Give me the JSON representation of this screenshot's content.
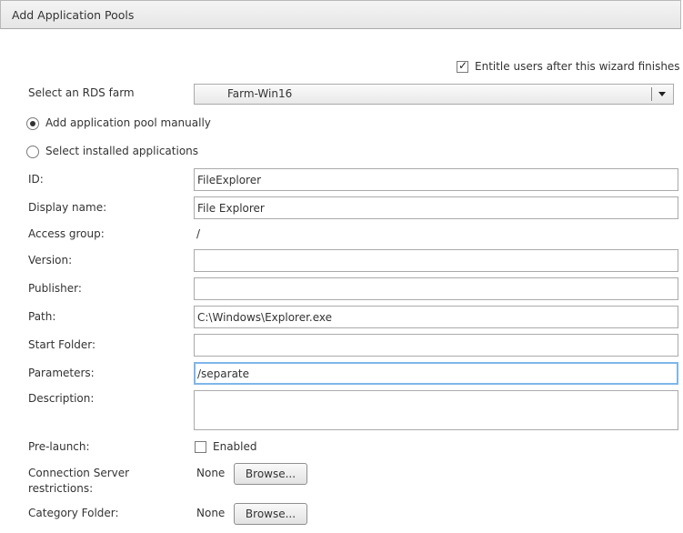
{
  "window": {
    "title": "Add Application Pools"
  },
  "entitle": {
    "label": "Entitle users after this wizard finishes",
    "checked": true
  },
  "farm": {
    "label": "Select an RDS farm",
    "value": "Farm-Win16"
  },
  "mode": {
    "manual_label": "Add application pool manually",
    "installed_label": "Select installed applications",
    "selected": "manual"
  },
  "fields": {
    "id": {
      "label": "ID:",
      "value": "FileExplorer"
    },
    "display_name": {
      "label": "Display name:",
      "value": "File Explorer"
    },
    "access_group": {
      "label": "Access group:",
      "value": "/"
    },
    "version": {
      "label": "Version:",
      "value": ""
    },
    "publisher": {
      "label": "Publisher:",
      "value": ""
    },
    "path": {
      "label": "Path:",
      "value": "C:\\Windows\\Explorer.exe"
    },
    "start_folder": {
      "label": "Start Folder:",
      "value": ""
    },
    "parameters": {
      "label": "Parameters:",
      "value": "/separate"
    },
    "description": {
      "label": "Description:",
      "value": ""
    }
  },
  "prelaunch": {
    "label": "Pre-launch:",
    "checkbox_label": "Enabled",
    "checked": false
  },
  "connection_server": {
    "label_line1": "Connection Server",
    "label_line2": "restrictions:",
    "value": "None",
    "button": "Browse..."
  },
  "category_folder": {
    "label": "Category Folder:",
    "value": "None",
    "button": "Browse..."
  }
}
